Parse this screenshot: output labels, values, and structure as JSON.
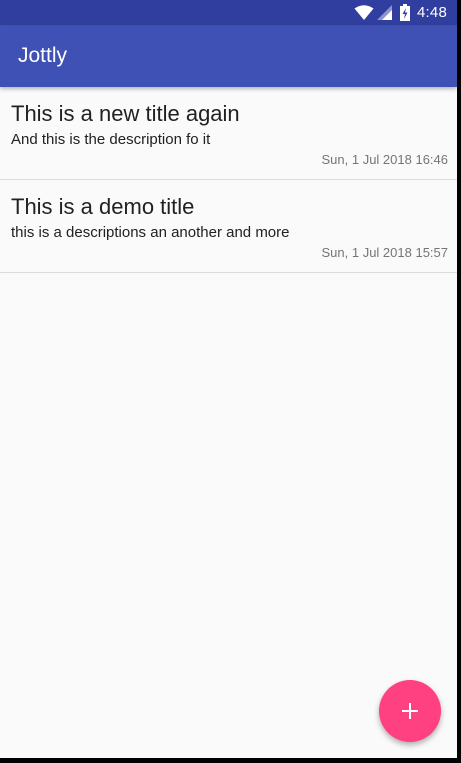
{
  "status_bar": {
    "time": "4:48",
    "icons": [
      "wifi-icon",
      "cell-signal-icon",
      "battery-charging-icon"
    ]
  },
  "app_bar": {
    "title": "Jottly"
  },
  "notes": [
    {
      "title": "This is a new title again",
      "description": "And this is the description fo it",
      "date": "Sun, 1 Jul 2018 16:46"
    },
    {
      "title": "This is a demo title",
      "description": "this is a descriptions an another and more",
      "date": "Sun, 1 Jul 2018 15:57"
    }
  ],
  "fab": {
    "icon": "plus-icon"
  },
  "colors": {
    "status_bar": "#303f9f",
    "app_bar": "#3f51b5",
    "accent": "#ff4081",
    "background": "#fafafa"
  }
}
